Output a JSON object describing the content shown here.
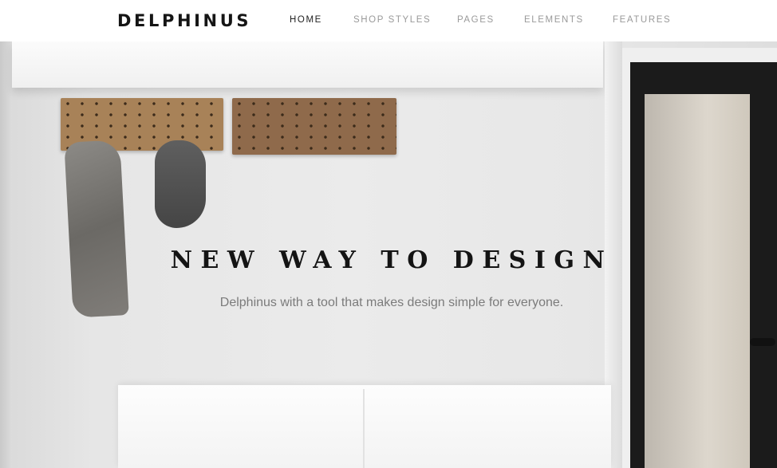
{
  "header": {
    "logo": "DELPHINUS",
    "nav": [
      {
        "label": "HOME",
        "active": true
      },
      {
        "label": "SHOP STYLES",
        "active": false
      },
      {
        "label": "PAGES",
        "active": false
      },
      {
        "label": "ELEMENTS",
        "active": false
      },
      {
        "label": "FEATURES",
        "active": false
      }
    ]
  },
  "hero": {
    "title": "NEW WAY TO DESIGN",
    "subtitle": "Delphinus with a tool that makes design simple for everyone."
  },
  "colors": {
    "header_bg": "#ffffff",
    "nav_active": "#222222",
    "nav_inactive": "#9a9a9a",
    "title": "#141414",
    "subtitle": "#7b7b7b"
  }
}
